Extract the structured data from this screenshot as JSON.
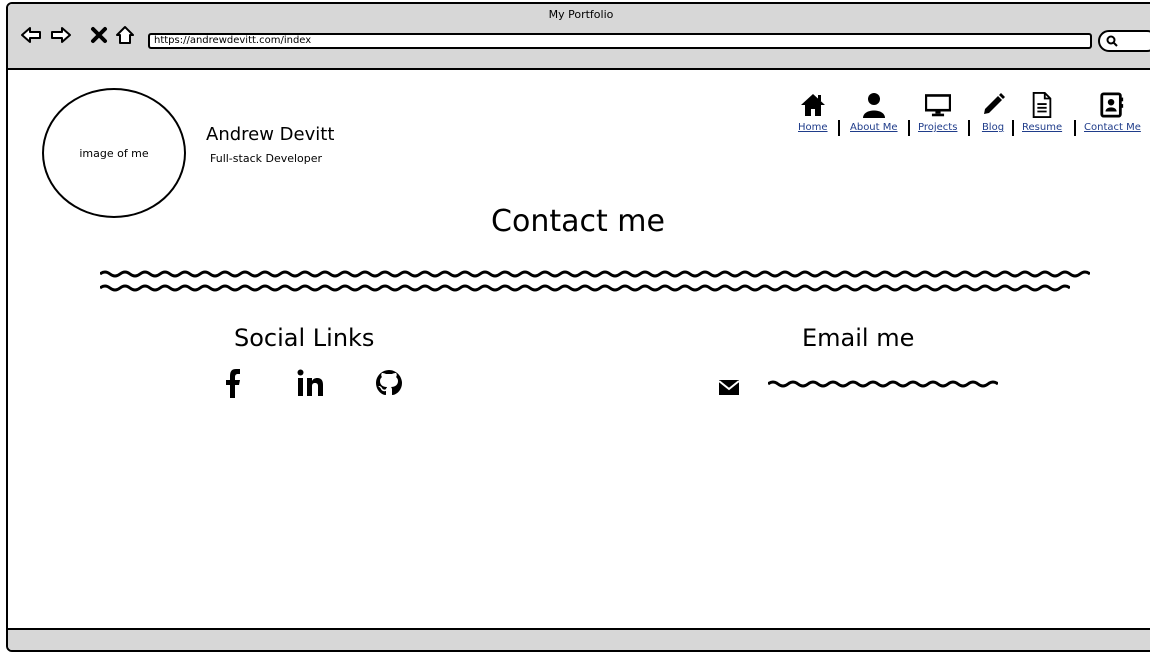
{
  "window": {
    "title": "My Portfolio",
    "url": "https://andrewdevitt.com/index"
  },
  "profile": {
    "image_label": "image of me",
    "name": "Andrew Devitt",
    "role": "Full-stack Developer"
  },
  "nav": {
    "items": [
      {
        "label": "Home",
        "icon": "home-icon"
      },
      {
        "label": "About Me",
        "icon": "user-icon"
      },
      {
        "label": "Projects",
        "icon": "monitor-icon"
      },
      {
        "label": "Blog",
        "icon": "pencil-icon"
      },
      {
        "label": "Resume",
        "icon": "document-icon"
      },
      {
        "label": "Contact Me",
        "icon": "contact-card-icon"
      }
    ]
  },
  "main": {
    "heading": "Contact me",
    "social_title": "Social Links",
    "social_icons": [
      "facebook-icon",
      "linkedin-icon",
      "github-icon"
    ],
    "email_title": "Email me",
    "email_icon": "envelope-icon"
  }
}
